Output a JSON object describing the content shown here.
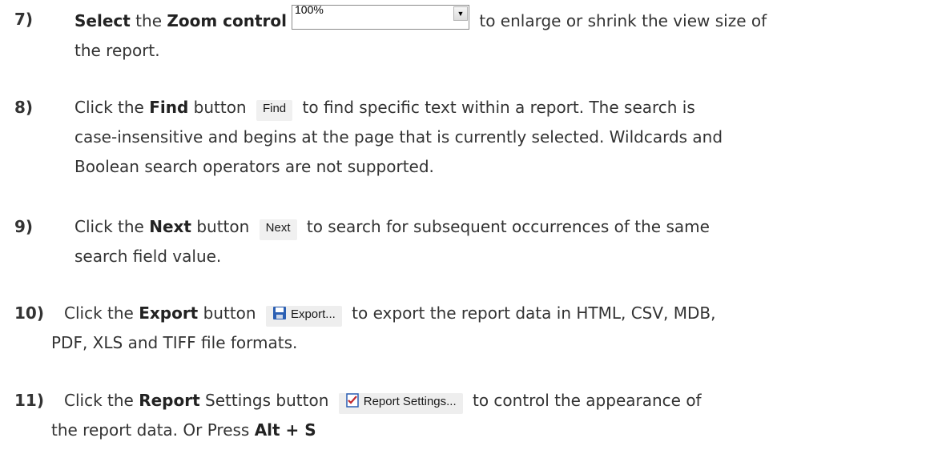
{
  "steps": [
    {
      "num": "7)",
      "pre": "",
      "bold1": "Select",
      "mid1": " the ",
      "bold2": "Zoom control",
      "after": " to enlarge or shrink the view size of",
      "line2": "the report.",
      "control": {
        "value": "100%"
      }
    },
    {
      "num": "8)",
      "pre": "Click the ",
      "bold": "Find",
      "mid": " button ",
      "button": "Find",
      "after": " to find specific text within a report. The search is",
      "line2": "case-insensitive and begins at the page that is currently selected. Wildcards and",
      "line3": "Boolean search operators are not supported."
    },
    {
      "num": "9)",
      "pre": "Click the ",
      "bold": "Next",
      "mid": " button ",
      "button": "Next",
      "after": " to search for subsequent occurrences of the same",
      "line2": "search field value."
    },
    {
      "num": "10)",
      "pre": "Click the ",
      "bold": "Export",
      "mid": " button ",
      "button": "Export...",
      "after": " to export the report data in HTML, CSV, MDB,",
      "line2": "PDF, XLS and TIFF file formats."
    },
    {
      "num": "11)",
      "pre": "Click the ",
      "bold": "Report",
      "mid": " Settings button ",
      "button": "Report Settings...",
      "after": " to control the appearance of",
      "line2": "the report data. Or Press ",
      "line2_bold": "Alt + S"
    }
  ],
  "colors": {
    "text": "#333333",
    "number": "#1f1f1f",
    "icon_blue": "#2b5fb3"
  },
  "icons": {
    "export": "save-disk-icon",
    "report_settings": "report-checklist-icon",
    "dropdown": "dropdown-arrow-icon"
  }
}
